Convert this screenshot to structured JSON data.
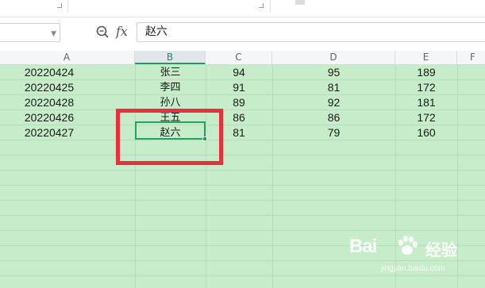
{
  "formula_bar": {
    "cell_reference": "",
    "fx_label": "fx",
    "value": "赵六"
  },
  "columns": [
    "A",
    "B",
    "C",
    "D",
    "E",
    "F"
  ],
  "rows": [
    {
      "a": "20220424",
      "b": "张三",
      "c": "94",
      "d": "95",
      "e": "189"
    },
    {
      "a": "20220425",
      "b": "李四",
      "c": "91",
      "d": "81",
      "e": "172"
    },
    {
      "a": "20220428",
      "b": "孙八",
      "c": "89",
      "d": "92",
      "e": "181"
    },
    {
      "a": "20220426",
      "b": "王五",
      "c": "86",
      "d": "86",
      "e": "172"
    },
    {
      "a": "20220427",
      "b": "赵六",
      "c": "81",
      "d": "79",
      "e": "160"
    }
  ],
  "selection": {
    "column": "B",
    "row_index": 5
  },
  "watermark": {
    "brand": "Bai",
    "name": "经验",
    "url": "jingyan.baidu.com"
  },
  "colors": {
    "grid_background": "#c7ecca",
    "selection": "#21a366",
    "annotation": "#e8313a"
  }
}
